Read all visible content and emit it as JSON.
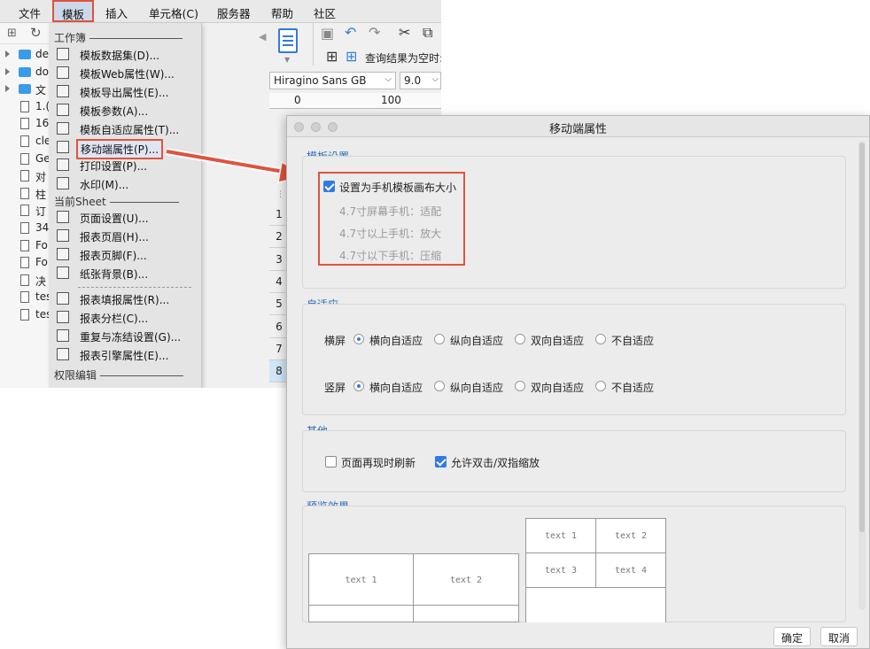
{
  "menubar": {
    "items": [
      "文件",
      "模板",
      "插入",
      "单元格(C)",
      "服务器",
      "帮助",
      "社区"
    ],
    "active_index": 1
  },
  "tree": {
    "items": [
      {
        "type": "folder",
        "label": "de"
      },
      {
        "type": "folder",
        "label": "do"
      },
      {
        "type": "folder",
        "label": "文"
      },
      {
        "type": "file",
        "label": "1.("
      },
      {
        "type": "file",
        "label": "16"
      },
      {
        "type": "file",
        "label": "cle"
      },
      {
        "type": "file",
        "label": "Ge"
      },
      {
        "type": "file",
        "label": "对"
      },
      {
        "type": "file",
        "label": "柱"
      },
      {
        "type": "file",
        "label": "订"
      },
      {
        "type": "file",
        "label": "34"
      },
      {
        "type": "file",
        "label": "Fo"
      },
      {
        "type": "file",
        "label": "Fo"
      },
      {
        "type": "file",
        "label": "决"
      },
      {
        "type": "file",
        "label": "tes"
      },
      {
        "type": "file",
        "label": "tes"
      }
    ]
  },
  "dropdown": {
    "section_workbook": "工作簿",
    "section_sheet": "当前Sheet",
    "section_permission": "权限编辑",
    "workbook_items": [
      {
        "label": "模板数据集(D)...",
        "icon": "database-icon"
      },
      {
        "label": "模板Web属性(W)...",
        "icon": "globe-icon"
      },
      {
        "label": "模板导出属性(E)...",
        "icon": "export-icon"
      },
      {
        "label": "模板参数(A)...",
        "icon": "parameter-icon"
      },
      {
        "label": "模板自适应属性(T)...",
        "icon": "adaptive-icon"
      },
      {
        "label": "移动端属性(P)...",
        "icon": "mobile-icon"
      },
      {
        "label": "打印设置(P)...",
        "icon": "printer-icon"
      },
      {
        "label": "水印(M)...",
        "icon": "watermark-icon"
      }
    ],
    "sheet_items": [
      {
        "label": "页面设置(U)...",
        "icon": "page-setup-icon"
      },
      {
        "label": "报表页眉(H)...",
        "icon": "header-icon"
      },
      {
        "label": "报表页脚(F)...",
        "icon": "footer-icon"
      },
      {
        "label": "纸张背景(B)...",
        "icon": "image-icon"
      },
      {
        "label": "报表填报属性(R)...",
        "icon": "fill-form-icon"
      },
      {
        "label": "报表分栏(C)...",
        "icon": "columns-icon"
      },
      {
        "label": "重复与冻结设置(G)...",
        "icon": "freeze-icon"
      },
      {
        "label": "报表引擎属性(E)...",
        "icon": "engine-icon"
      }
    ]
  },
  "editor": {
    "query_text": "查询结果为空时:",
    "font_name": "Hiragino Sans GB",
    "font_size": "9.0",
    "ruler_labels": [
      "0",
      "100"
    ],
    "row_numbers": [
      "1",
      "2",
      "3",
      "4",
      "5",
      "6",
      "7",
      "8"
    ]
  },
  "dialog": {
    "title": "移动端属性",
    "template_section": {
      "title": "模板设置",
      "checkbox_label": "设置为手机模板画布大小",
      "checked": true,
      "options": [
        "4.7寸屏幕手机：适配",
        "4.7寸以上手机：放大",
        "4.7寸以下手机：压缩"
      ]
    },
    "adaptive_section": {
      "title": "自适应",
      "horizontal_label": "横屏",
      "vertical_label": "竖屏",
      "options": [
        "横向自适应",
        "纵向自适应",
        "双向自适应",
        "不自适应"
      ],
      "horizontal_selected": 0,
      "vertical_selected": 0
    },
    "other_section": {
      "title": "其他",
      "refresh_label": "页面再现时刷新",
      "refresh_checked": false,
      "zoom_label": "允许双击/双指缩放",
      "zoom_checked": true
    },
    "preview_section": {
      "title": "预览效果",
      "left_cells": [
        "text 1",
        "text 2"
      ],
      "right_cells": [
        "text 1",
        "text 2",
        "text 3",
        "text 4"
      ]
    },
    "ok_label": "确定",
    "cancel_label": "取消"
  },
  "colors": {
    "accent": "#2f7ae5",
    "highlight": "#e0533d",
    "section_title": "#2a6ebb"
  }
}
